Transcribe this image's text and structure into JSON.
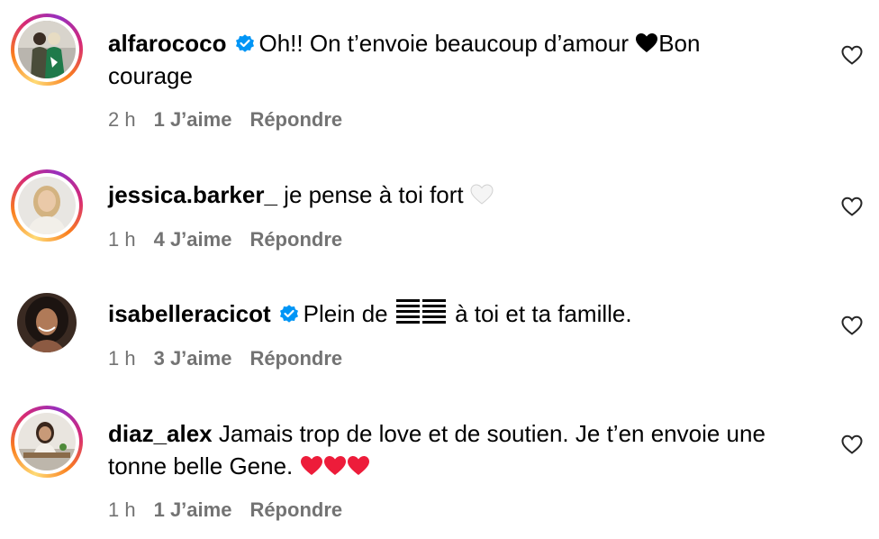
{
  "comments": [
    {
      "username": "alfarococo",
      "verified": true,
      "text_before": "Oh!! On t’envoie beaucoup d’amour ",
      "emoji": "🖤",
      "text_after": "Bon courage",
      "time": "2 h",
      "likes": "1 J’aime",
      "reply": "Répondre"
    },
    {
      "username": "jessica.barker_",
      "verified": false,
      "text": "je pense à toi fort ",
      "emoji": "🤍",
      "time": "1 h",
      "likes": "4 J’aime",
      "reply": "Répondre"
    },
    {
      "username": "isabelleracicot",
      "verified": true,
      "text_before": "Plein de ",
      "emoji": "🇵🇸",
      "text_after": " à toi et ta famille.",
      "time": "1 h",
      "likes": "3 J’aime",
      "reply": "Répondre"
    },
    {
      "username": "diaz_alex",
      "verified": false,
      "text_before": "Jamais trop de love et de soutien. Je t’en envoie une tonne belle Gene. ",
      "emoji": "❤️❤️❤️",
      "time": "1 h",
      "likes": "1 J’aime",
      "reply": "Répondre"
    }
  ],
  "colors": {
    "meta_gray": "#737373",
    "verified_blue": "#0095f6",
    "heart_red": "#ed1c3a"
  },
  "icons": {
    "verified": "verified-badge-icon",
    "like": "heart-outline-icon"
  }
}
